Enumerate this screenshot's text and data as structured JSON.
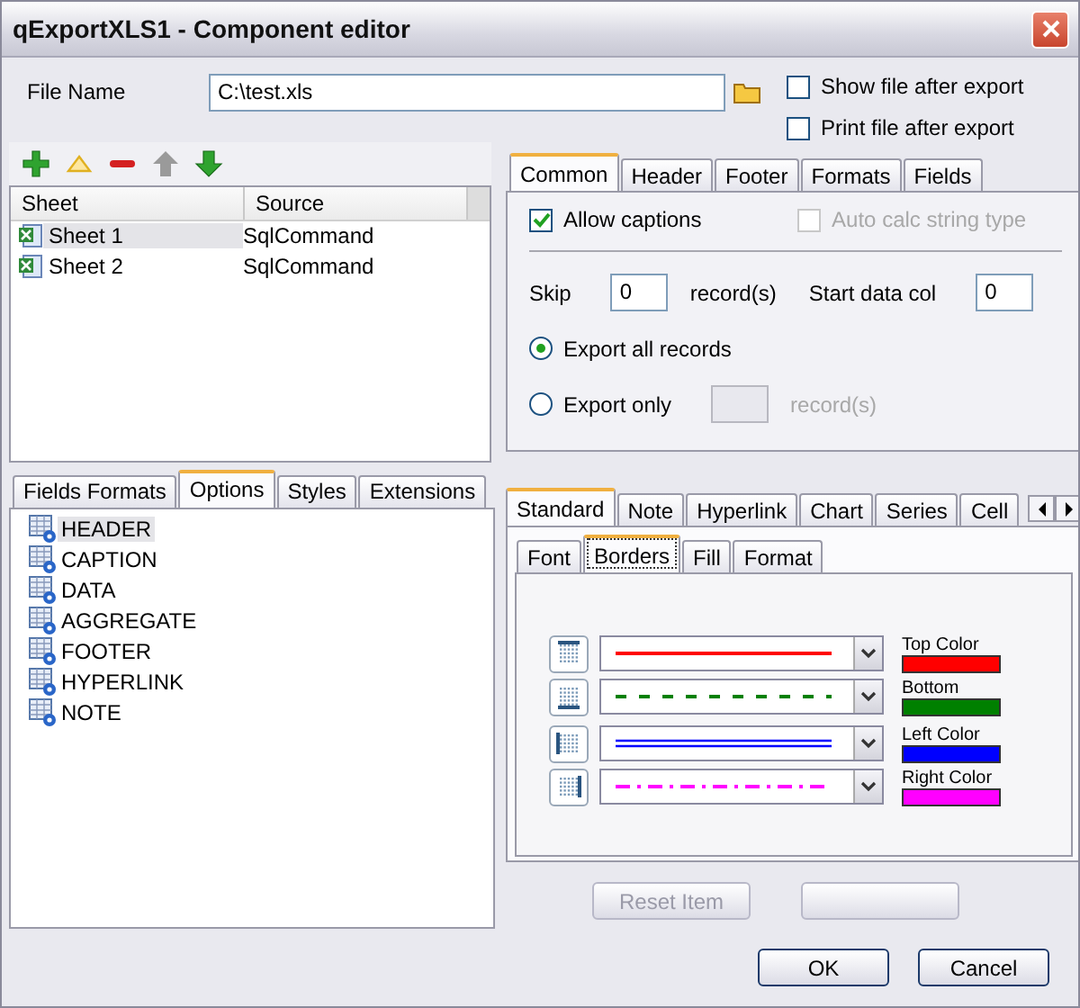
{
  "window": {
    "title": "qExportXLS1 - Component editor"
  },
  "file_name": {
    "label": "File Name",
    "value": "C:\\test.xls"
  },
  "options": [
    {
      "label": "Show file after export",
      "checked": false
    },
    {
      "label": "Print file after export",
      "checked": false
    }
  ],
  "toolbar": [
    {
      "kind": "add",
      "disabled": false
    },
    {
      "kind": "edit",
      "disabled": false
    },
    {
      "kind": "remove",
      "disabled": false
    },
    {
      "kind": "up",
      "disabled": true
    },
    {
      "kind": "down",
      "disabled": false
    }
  ],
  "sheets": {
    "columns": [
      "Sheet",
      "Source"
    ],
    "rows": [
      {
        "sheet": "Sheet 1",
        "source": "SqlCommand",
        "selected": true
      },
      {
        "sheet": "Sheet 2",
        "source": "SqlCommand",
        "selected": false
      }
    ]
  },
  "left_tabs": [
    {
      "label": "Fields Formats",
      "selected": false
    },
    {
      "label": "Options",
      "selected": true
    },
    {
      "label": "Styles",
      "selected": false
    },
    {
      "label": "Extensions",
      "selected": false
    }
  ],
  "tree_items": [
    {
      "label": "HEADER",
      "selected": true
    },
    {
      "label": "CAPTION",
      "selected": false
    },
    {
      "label": "DATA",
      "selected": false
    },
    {
      "label": "AGGREGATE",
      "selected": false
    },
    {
      "label": "FOOTER",
      "selected": false
    },
    {
      "label": "HYPERLINK",
      "selected": false
    },
    {
      "label": "NOTE",
      "selected": false
    }
  ],
  "common_tabs": [
    {
      "label": "Common",
      "selected": true
    },
    {
      "label": "Header",
      "selected": false
    },
    {
      "label": "Footer",
      "selected": false
    },
    {
      "label": "Formats",
      "selected": false
    },
    {
      "label": "Fields",
      "selected": false
    }
  ],
  "common": {
    "checks": [
      {
        "label": "Allow captions",
        "checked": true,
        "disabled": false
      },
      {
        "label": "Auto calc string type",
        "checked": false,
        "disabled": true
      }
    ],
    "skip": {
      "label": "Skip",
      "value": "0",
      "unit": "record(s)"
    },
    "start_col": {
      "label": "Start data col",
      "value": "0"
    },
    "export_modes": [
      {
        "label": "Export all records",
        "selected": true
      },
      {
        "label": "Export only",
        "selected": false,
        "unit": "record(s)"
      }
    ]
  },
  "format_tabs": [
    {
      "label": "Standard",
      "selected": true
    },
    {
      "label": "Note",
      "selected": false
    },
    {
      "label": "Hyperlink",
      "selected": false
    },
    {
      "label": "Chart",
      "selected": false
    },
    {
      "label": "Series",
      "selected": false
    },
    {
      "label": "Cell",
      "selected": false
    }
  ],
  "style_tabs": [
    {
      "label": "Font",
      "selected": false
    },
    {
      "label": "Borders",
      "selected": true
    },
    {
      "label": "Fill",
      "selected": false
    },
    {
      "label": "Format",
      "selected": false
    }
  ],
  "borders": [
    {
      "kind": "top",
      "label": "Top Color",
      "color": "#ff0000"
    },
    {
      "kind": "bottom",
      "label": "Bottom",
      "color": "#008000"
    },
    {
      "kind": "left",
      "label": "Left Color",
      "color": "#0000ff"
    },
    {
      "kind": "right",
      "label": "Right Color",
      "color": "#ff00ff"
    }
  ],
  "item_buttons": [
    {
      "label": "Reset Item",
      "disabled": true
    },
    {
      "disabled": true
    }
  ],
  "buttons": [
    {
      "label": "OK"
    },
    {
      "label": "Cancel"
    }
  ]
}
